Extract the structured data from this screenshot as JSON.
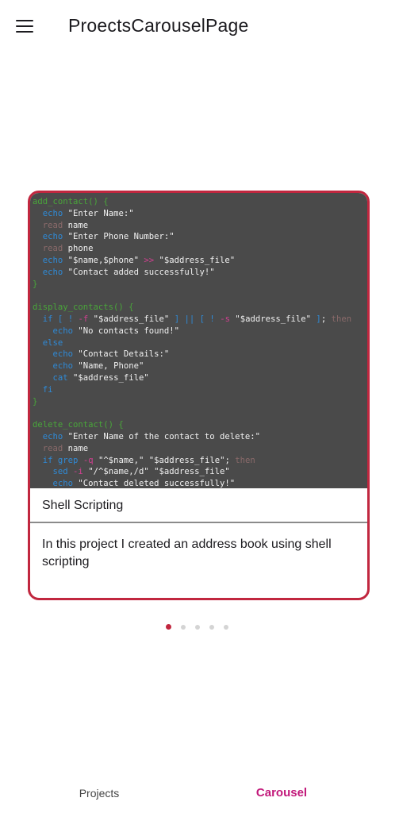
{
  "appbar": {
    "title": "ProectsCarouselPage",
    "menu_icon": "menu-icon"
  },
  "carousel": {
    "card": {
      "code_lines": [
        "add_contact() {",
        "  echo \"Enter Name:\"",
        "  read name",
        "  echo \"Enter Phone Number:\"",
        "  read phone",
        "  echo \"$name,$phone\" >> \"$address_file\"",
        "  echo \"Contact added successfully!\"",
        "}",
        "",
        "display_contacts() {",
        "  if [ ! -f \"$address_file\" ] || [ ! -s \"$address_file\" ]; then",
        "    echo \"No contacts found!\"",
        "  else",
        "    echo \"Contact Details:\"",
        "    echo \"Name, Phone\"",
        "    cat \"$address_file\"",
        "  fi",
        "}",
        "",
        "delete_contact() {",
        "  echo \"Enter Name of the contact to delete:\"",
        "  read name",
        "  if grep -q \"^$name,\" \"$address_file\"; then",
        "    sed -i \"/^$name,/d\" \"$address_file\"",
        "    echo \"Contact deleted successfully!\""
      ],
      "title": "Shell Scripting",
      "description": "In this project I created an address book using shell scripting"
    },
    "page_indicator": {
      "count": 5,
      "active_index": 0
    }
  },
  "bottom_nav": {
    "items": [
      {
        "label": "Projects",
        "selected": false
      },
      {
        "label": "Carousel",
        "selected": true
      }
    ]
  },
  "colors": {
    "accent": "#c1273f",
    "nav_selected": "#c2187a",
    "code_bg": "#4a4a4a"
  }
}
